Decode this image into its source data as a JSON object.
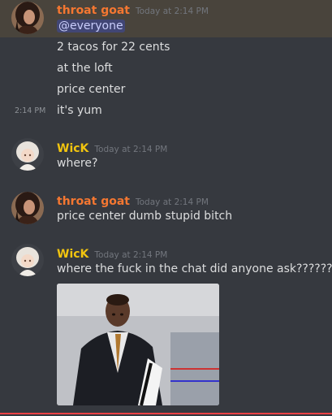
{
  "colors": {
    "background": "#36393f",
    "highlight_background": "#49443c",
    "throat_goat_name": "#f57731",
    "wick_name": "#f1c40f",
    "mention_bg": "#414675",
    "mention_text": "#c9cdfb",
    "timestamp": "#72767d",
    "message_text": "#dcddde",
    "new_messages_line": "#ed4245"
  },
  "messages": [
    {
      "author": "throat goat",
      "timestamp": "Today at 2:14 PM",
      "mention": "@everyone",
      "lines": [
        "2 tacos for 22 cents",
        "at the loft",
        "price center"
      ],
      "followup_time": "2:14 PM",
      "followup_text": "it's yum",
      "avatar_icon": "dark-hair-avatar-icon"
    },
    {
      "author": "WicK",
      "timestamp": "Today at 2:14 PM",
      "lines": [
        "where?"
      ],
      "avatar_icon": "anime-character-avatar-icon"
    },
    {
      "author": "throat goat",
      "timestamp": "Today at 2:14 PM",
      "lines": [
        "price center dumb stupid bitch"
      ],
      "avatar_icon": "dark-hair-avatar-icon"
    },
    {
      "author": "WicK",
      "timestamp": "Today at 2:14 PM",
      "lines": [
        "where the fuck in the chat did anyone ask??????"
      ],
      "attachment_icon": "man-in-suit-gif-icon",
      "avatar_icon": "anime-character-avatar-icon"
    }
  ]
}
